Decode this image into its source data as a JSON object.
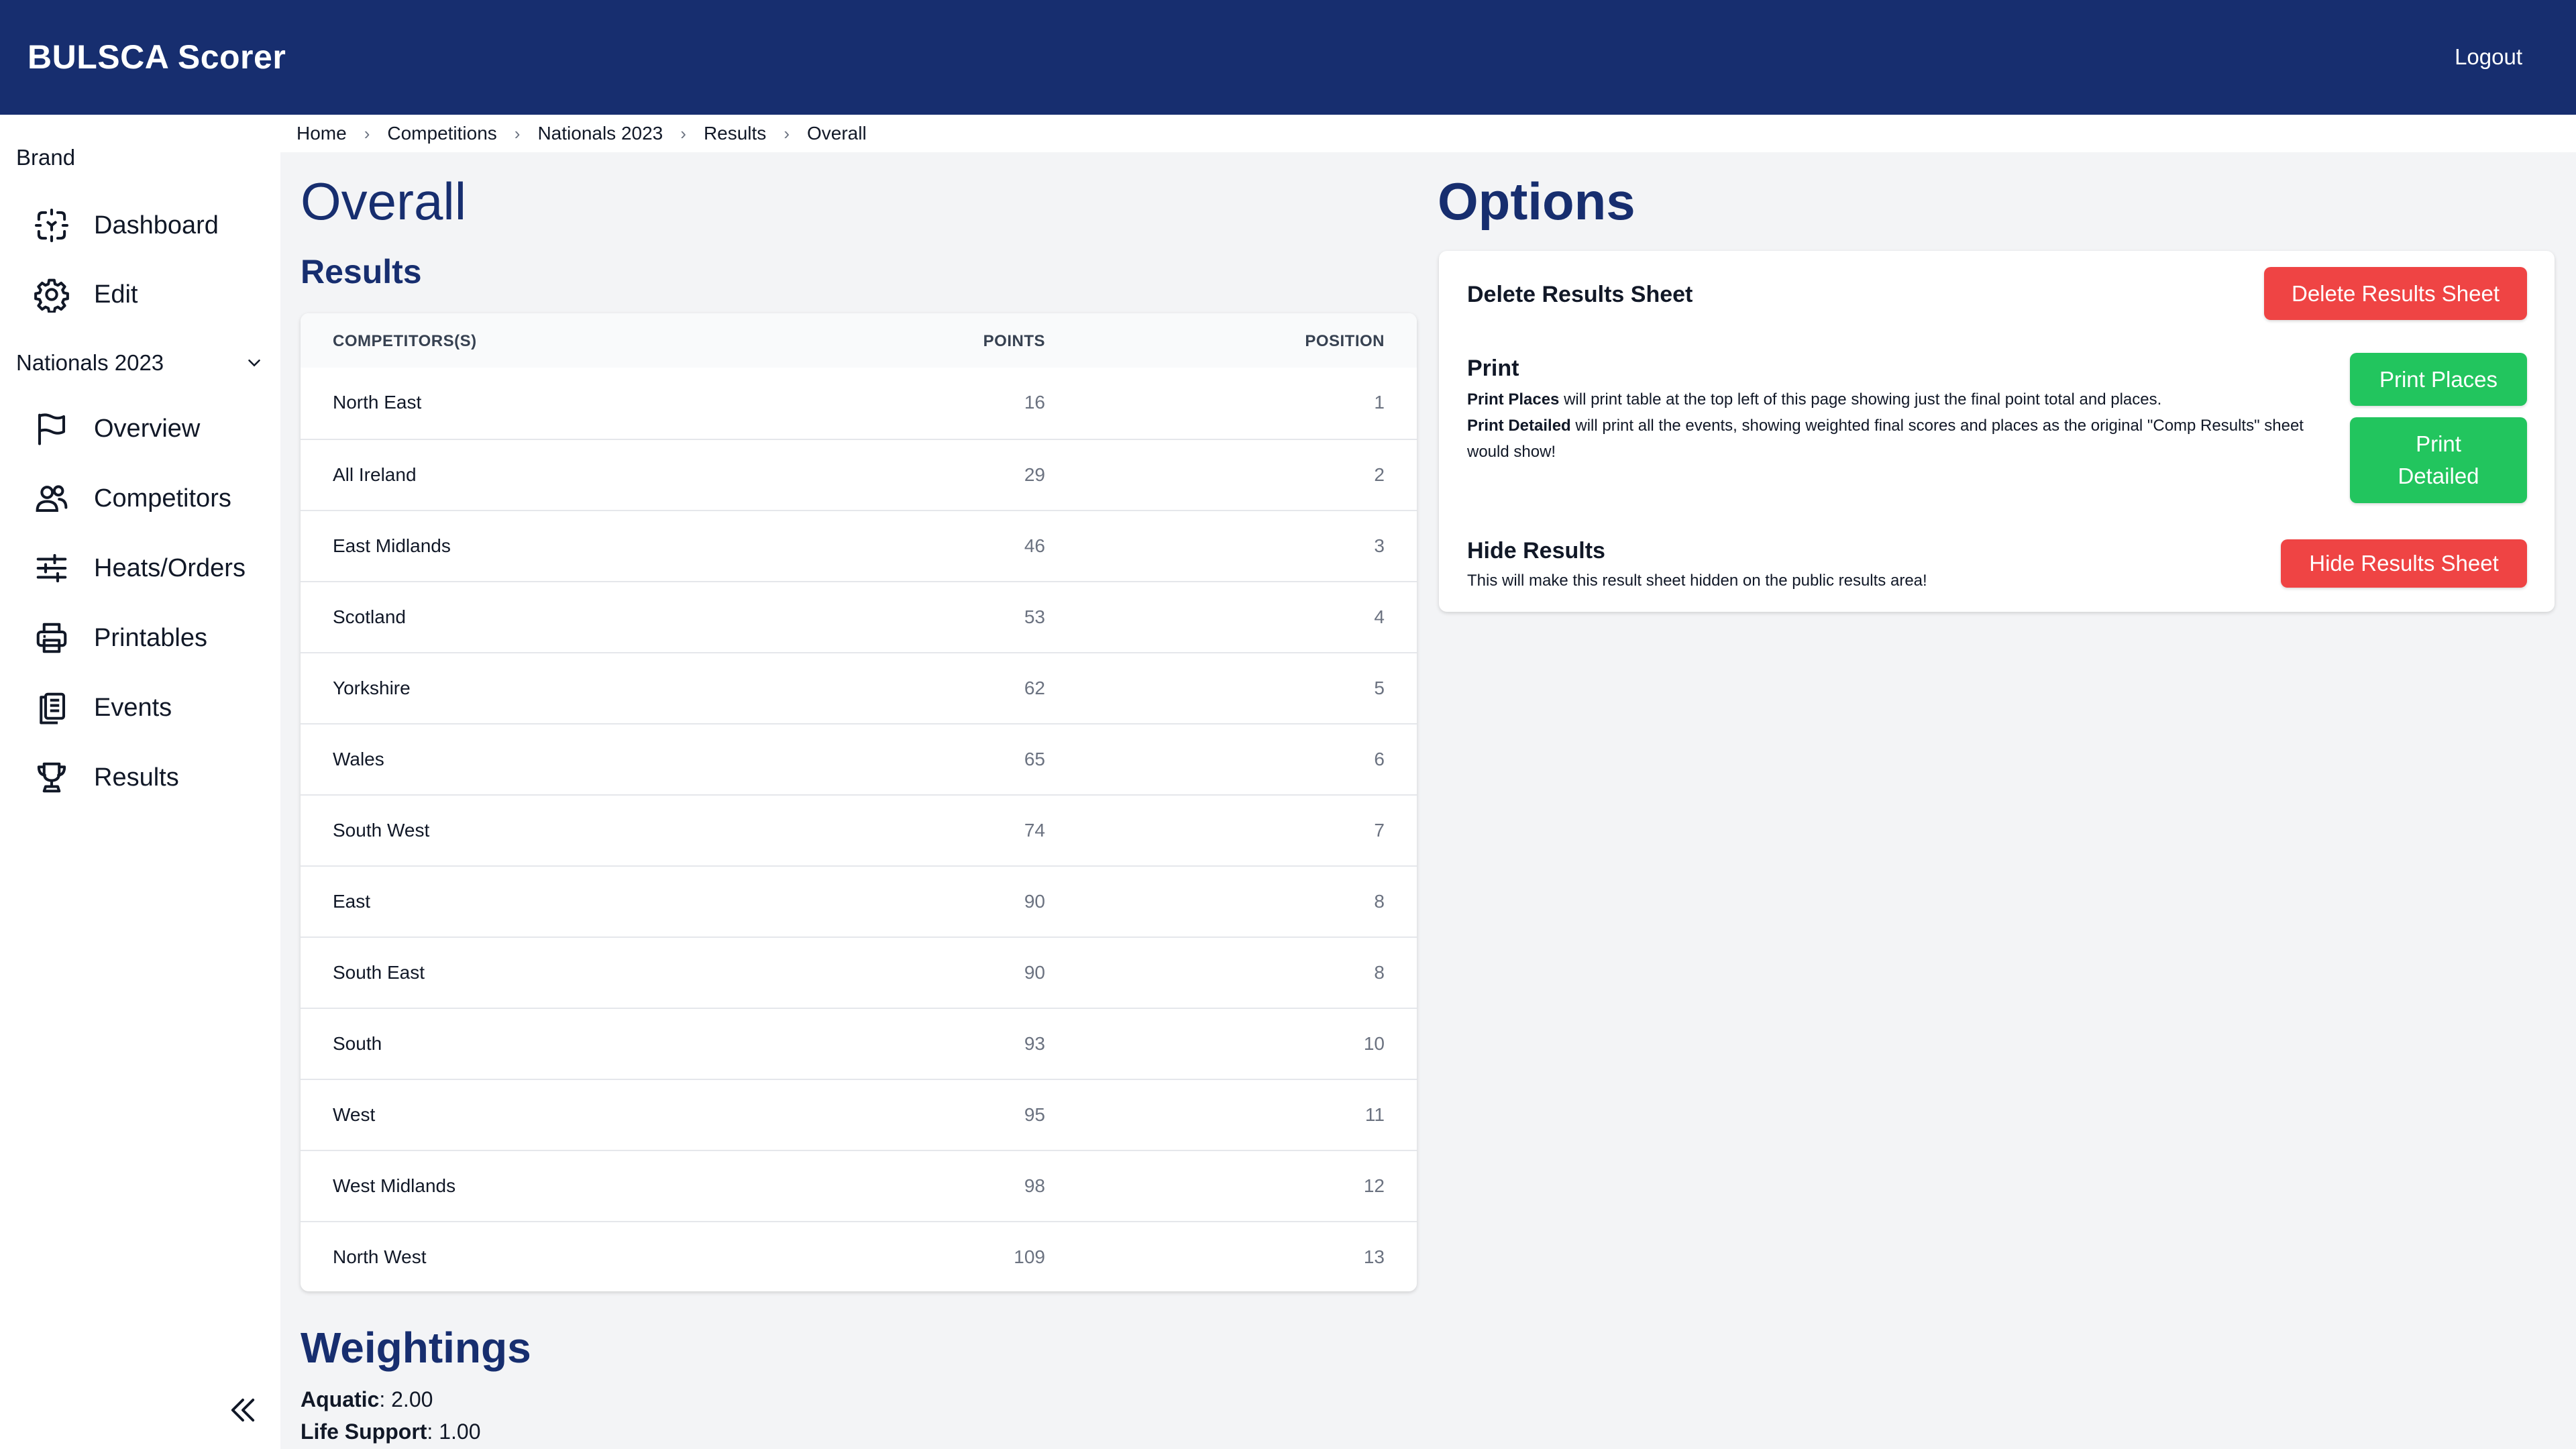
{
  "app": {
    "title": "BULSCA Scorer",
    "logout_label": "Logout"
  },
  "sidebar": {
    "brand_heading": "Brand",
    "top_items": [
      {
        "label": "Dashboard",
        "icon": "dashboard-icon"
      },
      {
        "label": "Edit",
        "icon": "gear-icon"
      }
    ],
    "group_label": "Nationals 2023",
    "group_items": [
      {
        "label": "Overview",
        "icon": "flag-icon"
      },
      {
        "label": "Competitors",
        "icon": "users-icon"
      },
      {
        "label": "Heats/Orders",
        "icon": "sliders-icon"
      },
      {
        "label": "Printables",
        "icon": "printer-icon"
      },
      {
        "label": "Events",
        "icon": "clipboard-icon"
      },
      {
        "label": "Results",
        "icon": "trophy-icon"
      }
    ]
  },
  "breadcrumb": [
    "Home",
    "Competitions",
    "Nationals 2023",
    "Results",
    "Overall"
  ],
  "main": {
    "title": "Overall",
    "results_heading": "Results",
    "table": {
      "headers": {
        "name": "COMPETITORS(S)",
        "points": "POINTS",
        "position": "POSITION"
      },
      "rows": [
        {
          "name": "North East",
          "points": "16",
          "position": "1"
        },
        {
          "name": "All Ireland",
          "points": "29",
          "position": "2"
        },
        {
          "name": "East Midlands",
          "points": "46",
          "position": "3"
        },
        {
          "name": "Scotland",
          "points": "53",
          "position": "4"
        },
        {
          "name": "Yorkshire",
          "points": "62",
          "position": "5"
        },
        {
          "name": "Wales",
          "points": "65",
          "position": "6"
        },
        {
          "name": "South West",
          "points": "74",
          "position": "7"
        },
        {
          "name": "East",
          "points": "90",
          "position": "8"
        },
        {
          "name": "South East",
          "points": "90",
          "position": "8"
        },
        {
          "name": "South",
          "points": "93",
          "position": "10"
        },
        {
          "name": "West",
          "points": "95",
          "position": "11"
        },
        {
          "name": "West Midlands",
          "points": "98",
          "position": "12"
        },
        {
          "name": "North West",
          "points": "109",
          "position": "13"
        }
      ]
    },
    "weightings": {
      "heading": "Weightings",
      "items": [
        {
          "label": "Aquatic",
          "value": "2.00"
        },
        {
          "label": "Life Support",
          "value": "1.00"
        }
      ]
    }
  },
  "options": {
    "heading": "Options",
    "delete": {
      "title": "Delete Results Sheet",
      "button": "Delete Results Sheet"
    },
    "print": {
      "title": "Print",
      "places_bold": "Print Places",
      "places_text": " will print table at the top left of this page showing just the final point total and places.",
      "detailed_bold": "Print Detailed",
      "detailed_text": " will print all the events, showing weighted final scores and places as the original \"Comp Results\" sheet would show!",
      "places_button": "Print Places",
      "detailed_button_line1": "Print",
      "detailed_button_line2": "Detailed"
    },
    "hide": {
      "title": "Hide Results",
      "desc": "This will make this result sheet hidden on the public results area!",
      "button": "Hide Results Sheet"
    }
  },
  "colors": {
    "brand": "#172e6f",
    "danger": "#ef4444",
    "success": "#22c55e",
    "background": "#f3f4f6"
  }
}
